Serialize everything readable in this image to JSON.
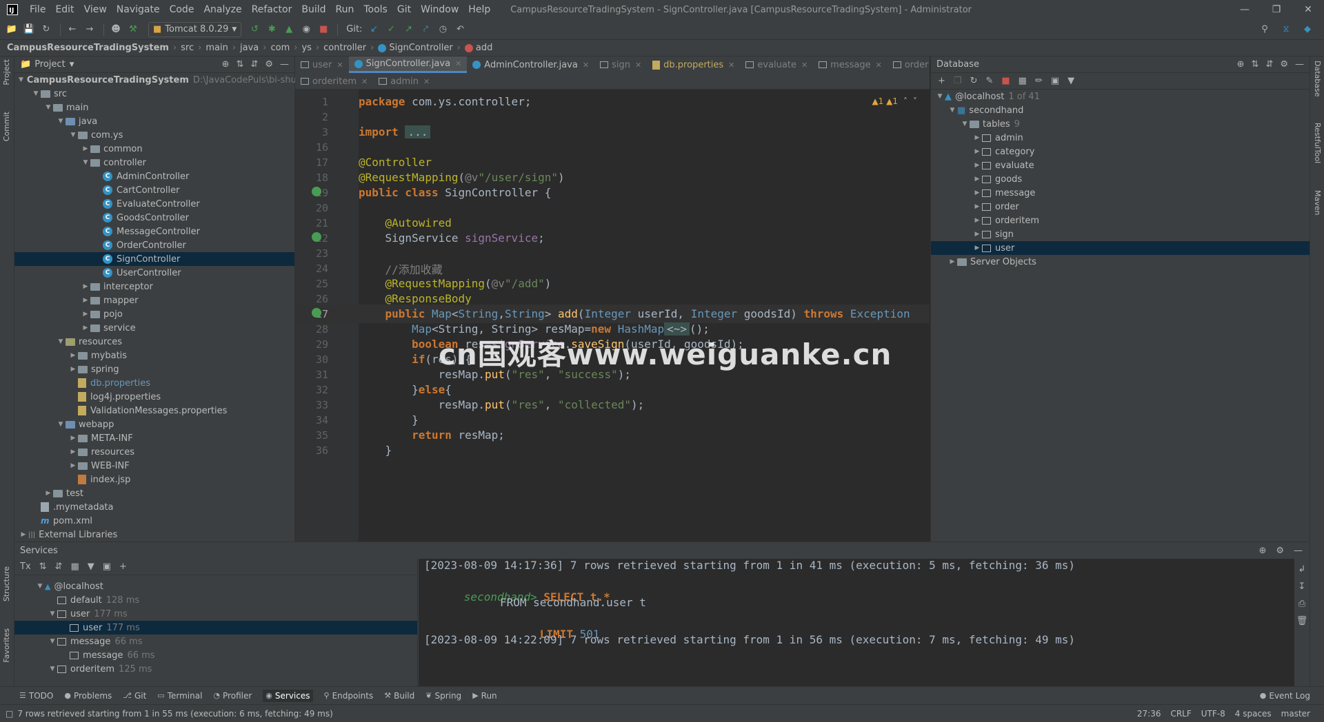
{
  "menubar": {
    "items": [
      "File",
      "Edit",
      "View",
      "Navigate",
      "Code",
      "Analyze",
      "Refactor",
      "Build",
      "Run",
      "Tools",
      "Git",
      "Window",
      "Help"
    ],
    "window_title": "CampusResourceTradingSystem - SignController.java [CampusResourceTradingSystem] - Administrator"
  },
  "toolbar": {
    "run_config": "Tomcat 8.0.29",
    "git_label": "Git:"
  },
  "breadcrumb": [
    "CampusResourceTradingSystem",
    "src",
    "main",
    "java",
    "com",
    "ys",
    "controller",
    "SignController",
    "add"
  ],
  "project": {
    "header": "Project",
    "root": "CampusResourceTradingSystem",
    "root_path": "D:\\JavaCodePuls\\bi-shu\\Ca",
    "tree": [
      {
        "label": "src",
        "depth": 1,
        "arrow": "v",
        "icon": "folder"
      },
      {
        "label": "main",
        "depth": 2,
        "arrow": "v",
        "icon": "folder"
      },
      {
        "label": "java",
        "depth": 3,
        "arrow": "v",
        "icon": "folder-blue"
      },
      {
        "label": "com.ys",
        "depth": 4,
        "arrow": "v",
        "icon": "folder"
      },
      {
        "label": "common",
        "depth": 5,
        "arrow": ">",
        "icon": "folder"
      },
      {
        "label": "controller",
        "depth": 5,
        "arrow": "v",
        "icon": "folder"
      },
      {
        "label": "AdminController",
        "depth": 6,
        "arrow": "",
        "icon": "class"
      },
      {
        "label": "CartController",
        "depth": 6,
        "arrow": "",
        "icon": "class"
      },
      {
        "label": "EvaluateController",
        "depth": 6,
        "arrow": "",
        "icon": "class"
      },
      {
        "label": "GoodsController",
        "depth": 6,
        "arrow": "",
        "icon": "class"
      },
      {
        "label": "MessageController",
        "depth": 6,
        "arrow": "",
        "icon": "class"
      },
      {
        "label": "OrderController",
        "depth": 6,
        "arrow": "",
        "icon": "class"
      },
      {
        "label": "SignController",
        "depth": 6,
        "arrow": "",
        "icon": "class",
        "selected": true
      },
      {
        "label": "UserController",
        "depth": 6,
        "arrow": "",
        "icon": "class"
      },
      {
        "label": "interceptor",
        "depth": 5,
        "arrow": ">",
        "icon": "folder"
      },
      {
        "label": "mapper",
        "depth": 5,
        "arrow": ">",
        "icon": "folder"
      },
      {
        "label": "pojo",
        "depth": 5,
        "arrow": ">",
        "icon": "folder"
      },
      {
        "label": "service",
        "depth": 5,
        "arrow": ">",
        "icon": "folder"
      },
      {
        "label": "resources",
        "depth": 3,
        "arrow": "v",
        "icon": "folder-res"
      },
      {
        "label": "mybatis",
        "depth": 4,
        "arrow": ">",
        "icon": "folder"
      },
      {
        "label": "spring",
        "depth": 4,
        "arrow": ">",
        "icon": "folder"
      },
      {
        "label": "db.properties",
        "depth": 4,
        "arrow": "",
        "icon": "props",
        "color": "#6897bb"
      },
      {
        "label": "log4j.properties",
        "depth": 4,
        "arrow": "",
        "icon": "props"
      },
      {
        "label": "ValidationMessages.properties",
        "depth": 4,
        "arrow": "",
        "icon": "props"
      },
      {
        "label": "webapp",
        "depth": 3,
        "arrow": "v",
        "icon": "folder-blue"
      },
      {
        "label": "META-INF",
        "depth": 4,
        "arrow": ">",
        "icon": "folder"
      },
      {
        "label": "resources",
        "depth": 4,
        "arrow": ">",
        "icon": "folder"
      },
      {
        "label": "WEB-INF",
        "depth": 4,
        "arrow": ">",
        "icon": "folder"
      },
      {
        "label": "index.jsp",
        "depth": 4,
        "arrow": "",
        "icon": "jsp"
      },
      {
        "label": "test",
        "depth": 2,
        "arrow": ">",
        "icon": "folder"
      },
      {
        "label": ".mymetadata",
        "depth": 1,
        "arrow": "",
        "icon": "file"
      },
      {
        "label": "pom.xml",
        "depth": 1,
        "arrow": "",
        "icon": "m"
      },
      {
        "label": "External Libraries",
        "depth": 0,
        "arrow": ">",
        "icon": "lib"
      }
    ]
  },
  "editor": {
    "tabs_row1": [
      {
        "label": "user",
        "icon": "table",
        "dim": true
      },
      {
        "label": "SignController.java",
        "icon": "class",
        "active": true
      },
      {
        "label": "AdminController.java",
        "icon": "class"
      },
      {
        "label": "sign",
        "icon": "table",
        "dim": true
      },
      {
        "label": "db.properties",
        "icon": "props"
      },
      {
        "label": "evaluate",
        "icon": "table",
        "dim": true
      },
      {
        "label": "message",
        "icon": "table",
        "dim": true
      },
      {
        "label": "order",
        "icon": "table",
        "dim": true
      }
    ],
    "tabs_row2": [
      {
        "label": "orderitem",
        "icon": "table",
        "dim": true
      },
      {
        "label": "admin",
        "icon": "table",
        "dim": true
      }
    ],
    "inspections": "▲1  ▲1",
    "lines": [
      {
        "n": "1",
        "segs": [
          [
            "kw",
            "package "
          ],
          [
            "typ",
            "com.ys.controller;"
          ]
        ]
      },
      {
        "n": "2",
        "segs": []
      },
      {
        "n": "3",
        "segs": [
          [
            "kw",
            "import "
          ],
          [
            "fold",
            "..."
          ]
        ]
      },
      {
        "n": "16",
        "segs": []
      },
      {
        "n": "17",
        "segs": [
          [
            "ann",
            "@Controller"
          ]
        ]
      },
      {
        "n": "18",
        "segs": [
          [
            "ann",
            "@RequestMapping"
          ],
          [
            "typ",
            "("
          ],
          [
            "cmt",
            "@v"
          ],
          [
            "str",
            "\"/user/sign\""
          ],
          [
            "typ",
            ")"
          ]
        ]
      },
      {
        "n": "19",
        "segs": [
          [
            "kw",
            "public class "
          ],
          [
            "typ",
            "SignController {"
          ]
        ],
        "gicon": true
      },
      {
        "n": "20",
        "segs": []
      },
      {
        "n": "21",
        "segs": [
          [
            "typ",
            "    "
          ],
          [
            "ann",
            "@Autowired"
          ]
        ]
      },
      {
        "n": "22",
        "segs": [
          [
            "typ",
            "    SignService "
          ],
          [
            "fld",
            "signService"
          ],
          [
            "typ",
            ";"
          ]
        ],
        "gicon": true
      },
      {
        "n": "23",
        "segs": []
      },
      {
        "n": "24",
        "segs": [
          [
            "cmt",
            "    //添加收藏"
          ]
        ]
      },
      {
        "n": "25",
        "segs": [
          [
            "typ",
            "    "
          ],
          [
            "ann",
            "@RequestMapping"
          ],
          [
            "typ",
            "("
          ],
          [
            "cmt",
            "@v"
          ],
          [
            "str",
            "\"/add\""
          ],
          [
            "typ",
            ")"
          ]
        ]
      },
      {
        "n": "26",
        "segs": [
          [
            "typ",
            "    "
          ],
          [
            "ann",
            "@ResponseBody"
          ]
        ]
      },
      {
        "n": "27",
        "segs": [
          [
            "typ",
            "    "
          ],
          [
            "kw",
            "public "
          ],
          [
            "ty2",
            "Map"
          ],
          [
            "typ",
            "<"
          ],
          [
            "ty2",
            "String"
          ],
          [
            "typ",
            ","
          ],
          [
            "ty2",
            "String"
          ],
          [
            "typ",
            "> "
          ],
          [
            "fn",
            "add"
          ],
          [
            "typ",
            "("
          ],
          [
            "ty2",
            "Integer"
          ],
          [
            "typ",
            " userId, "
          ],
          [
            "ty2",
            "Integer"
          ],
          [
            "typ",
            " goodsId) "
          ],
          [
            "kw",
            "throws "
          ],
          [
            "ty2",
            "Exception"
          ]
        ],
        "gicon": true,
        "current": true
      },
      {
        "n": "28",
        "segs": [
          [
            "typ",
            "        "
          ],
          [
            "ty2",
            "Map"
          ],
          [
            "typ",
            "<String, String> resMap="
          ],
          [
            "kw",
            "new "
          ],
          [
            "ty2",
            "HashMap"
          ],
          [
            "fold",
            "<~>"
          ],
          [
            "typ",
            "();"
          ]
        ]
      },
      {
        "n": "29",
        "segs": [
          [
            "typ",
            "        "
          ],
          [
            "kw",
            "boolean "
          ],
          [
            "typ",
            "res="
          ],
          [
            "fld",
            "signService"
          ],
          [
            "typ",
            "."
          ],
          [
            "fn",
            "saveSign"
          ],
          [
            "typ",
            "(userId, goodsId);"
          ]
        ]
      },
      {
        "n": "30",
        "segs": [
          [
            "typ",
            "        "
          ],
          [
            "kw",
            "if"
          ],
          [
            "typ",
            "(res) {"
          ]
        ]
      },
      {
        "n": "31",
        "segs": [
          [
            "typ",
            "            resMap."
          ],
          [
            "fn",
            "put"
          ],
          [
            "typ",
            "("
          ],
          [
            "str",
            "\"res\""
          ],
          [
            "typ",
            ", "
          ],
          [
            "str",
            "\"success\""
          ],
          [
            "typ",
            ");"
          ]
        ]
      },
      {
        "n": "32",
        "segs": [
          [
            "typ",
            "        }"
          ],
          [
            "kw",
            "else"
          ],
          [
            "typ",
            "{"
          ]
        ]
      },
      {
        "n": "33",
        "segs": [
          [
            "typ",
            "            resMap."
          ],
          [
            "fn",
            "put"
          ],
          [
            "typ",
            "("
          ],
          [
            "str",
            "\"res\""
          ],
          [
            "typ",
            ", "
          ],
          [
            "str",
            "\"collected\""
          ],
          [
            "typ",
            ");"
          ]
        ]
      },
      {
        "n": "34",
        "segs": [
          [
            "typ",
            "        }"
          ]
        ]
      },
      {
        "n": "35",
        "segs": [
          [
            "typ",
            "        "
          ],
          [
            "kw",
            "return "
          ],
          [
            "typ",
            "resMap;"
          ]
        ]
      },
      {
        "n": "36",
        "segs": [
          [
            "typ",
            "    }"
          ]
        ]
      }
    ]
  },
  "database": {
    "header": "Database",
    "host": "@localhost",
    "host_count": "1 of 41",
    "schema": "secondhand",
    "tables_label": "tables",
    "tables_count": "9",
    "tables": [
      "admin",
      "category",
      "evaluate",
      "goods",
      "message",
      "order",
      "orderitem",
      "sign",
      "user"
    ],
    "selected_table": "user",
    "server_objects": "Server Objects"
  },
  "services": {
    "header": "Services",
    "tree": [
      {
        "label": "@localhost",
        "depth": 0,
        "arrow": "v",
        "time": ""
      },
      {
        "label": "default",
        "depth": 1,
        "arrow": "",
        "time": "128 ms"
      },
      {
        "label": "user",
        "depth": 1,
        "arrow": "v",
        "time": "177 ms"
      },
      {
        "label": "user",
        "depth": 2,
        "arrow": "",
        "time": "177 ms",
        "selected": true
      },
      {
        "label": "message",
        "depth": 1,
        "arrow": "v",
        "time": "66 ms"
      },
      {
        "label": "message",
        "depth": 2,
        "arrow": "",
        "time": "66 ms"
      },
      {
        "label": "orderitem",
        "depth": 1,
        "arrow": "v",
        "time": "125 ms"
      }
    ],
    "console": {
      "line1": "[2023-08-09 14:17:36] 7 rows retrieved starting from 1 in 41 ms (execution: 5 ms, fetching: 36 ms)",
      "prompt": "secondhand>",
      "sql1": "SELECT t.*",
      "sql2": "FROM secondhand.user t",
      "sql3_kw": "LIMIT",
      "sql3_num": "501",
      "line5": "[2023-08-09 14:22:09] 7 rows retrieved starting from 1 in 56 ms (execution: 7 ms, fetching: 49 ms)"
    }
  },
  "bottom_tools": [
    "TODO",
    "Problems",
    "Git",
    "Terminal",
    "Profiler",
    "Services",
    "Endpoints",
    "Build",
    "Spring",
    "Run"
  ],
  "bottom_active": "Services",
  "event_log": "Event Log",
  "status": {
    "message": "7 rows retrieved starting from 1 in 55 ms (execution: 6 ms, fetching: 49 ms)",
    "position": "27:36",
    "line_sep": "CRLF",
    "encoding": "UTF-8",
    "indent": "4 spaces",
    "branch": "master"
  },
  "side_labels": {
    "left": [
      "Project",
      "Commit",
      "Structure",
      "Favorites"
    ],
    "right": [
      "Database",
      "RestfulTool",
      "Maven"
    ]
  },
  "watermark": "cn国观客www.weiguanke.cn"
}
